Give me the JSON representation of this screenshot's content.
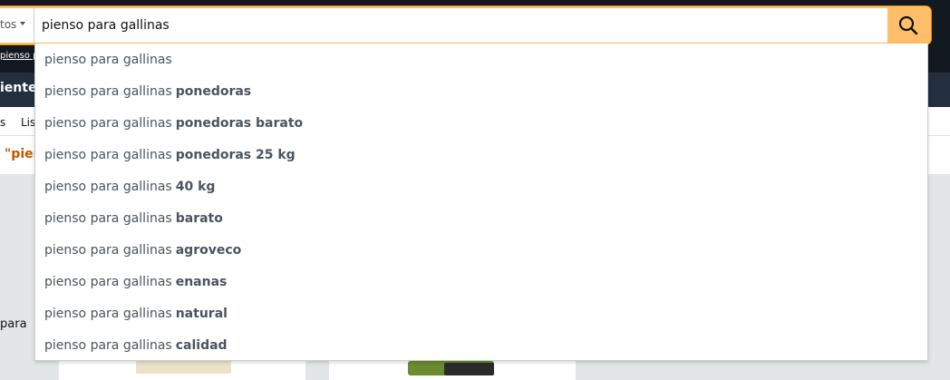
{
  "header": {
    "department_label": "tos",
    "breadcrumb_text": "pienso p",
    "nav_item": "iente",
    "sub_nav": [
      "s",
      "Lis"
    ],
    "results_prefix": "\"pien",
    "side_text": "para"
  },
  "search": {
    "query": "pienso para gallinas",
    "button_icon": "search-icon"
  },
  "suggestions": {
    "items": [
      {
        "prefix": "pienso para gallinas",
        "completion": ""
      },
      {
        "prefix": "pienso para gallinas",
        "completion": "ponedoras"
      },
      {
        "prefix": "pienso para gallinas",
        "completion": "ponedoras barato"
      },
      {
        "prefix": "pienso para gallinas",
        "completion": "ponedoras 25 kg"
      },
      {
        "prefix": "pienso para gallinas",
        "completion": "40 kg"
      },
      {
        "prefix": "pienso para gallinas",
        "completion": "barato"
      },
      {
        "prefix": "pienso para gallinas",
        "completion": "agroveco"
      },
      {
        "prefix": "pienso para gallinas",
        "completion": "enanas"
      },
      {
        "prefix": "pienso para gallinas",
        "completion": "natural"
      },
      {
        "prefix": "pienso para gallinas",
        "completion": "calidad"
      }
    ]
  },
  "colors": {
    "header_dark": "#131921",
    "nav_dark": "#232f3e",
    "search_button": "#febd69",
    "focus_ring": "#f08804",
    "suggestion_text": "#4b545e",
    "results_orange": "#c45500"
  }
}
